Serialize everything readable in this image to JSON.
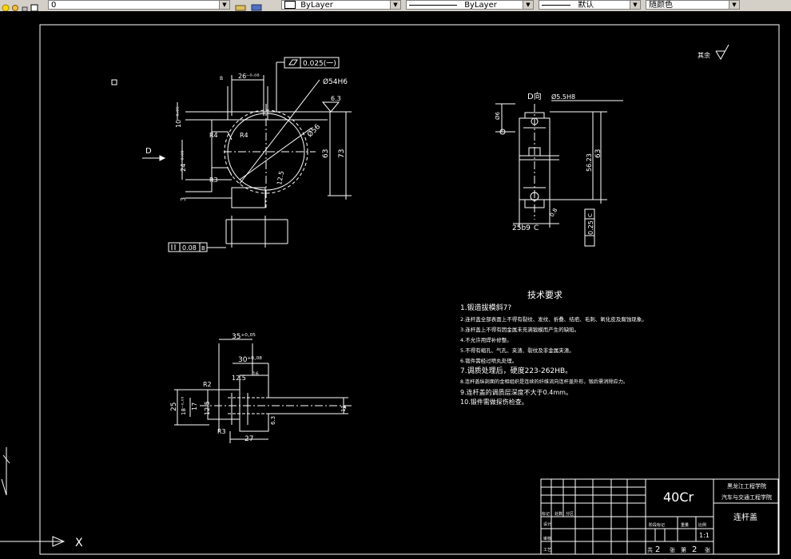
{
  "toolbar": {
    "layer_value": "0",
    "color_combo": "ByLayer",
    "linetype_combo": "ByLayer",
    "lineweight_combo": "默认",
    "plotstyle_combo": "随颜色"
  },
  "drawing": {
    "roughness_note": "其余",
    "view_arrow_label": "D",
    "view_d_label": "D向",
    "flatness_tol": "0.025(一)",
    "parallel_tol": "0.08",
    "parallel_datum": "B",
    "perp_tol": "0.25",
    "perp_datum": "C",
    "dims_main": {
      "d26": "26⁻⁰·⁰⁸",
      "d54": "Ø54H6",
      "d56": "Ø56",
      "d63": "63",
      "d73": "73",
      "r4a": "R4",
      "r4b": "R4",
      "d12_5": "12.5",
      "d10": "10⁻⁰·⁰⁵",
      "d24": "24⁻⁰·⁰⁸",
      "d3": "3",
      "r3": "R3",
      "rough63": "6.3"
    },
    "dims_side": {
      "d55": "Ø5.5H8",
      "d6": "Ø6",
      "d5623": "56.23",
      "d63": "63",
      "d25b9": "25b9",
      "rough16": "1.6",
      "rough32": "3.2",
      "rough08": "0.8"
    },
    "dims_bottom": {
      "d35": "35⁺⁰·⁰⁵",
      "d30": "30⁺⁰·⁰⁸",
      "d12_5": "12.5",
      "d16": "16",
      "d25": "25",
      "d17": "17",
      "d18": "18⁻⁰·⁰⁵",
      "d12_5v": "12.5",
      "d27": "27",
      "r2": "R2",
      "r3": "R3",
      "r05": "R0.5",
      "d4": "4",
      "d11": "11",
      "rough": "6.3"
    },
    "tech_title": "技术要求",
    "tech_items": [
      "1.锻造拔模斜7?",
      "2.连杆盖全部表面上不得有裂纹、发纹、折叠、结疤、毛刺、氧化皮及腐蚀现象。",
      "3.连杆盖上不得有因金属未充满锻模而产生的缺陷。",
      "4.不允许用焊补修整。",
      "5.不得有缩孔、气孔、夹渣、裂纹及非金属夹渣。",
      "6.锻件需经过喷丸处理。",
      "7.调质处理后，硬度223-262HB。",
      "8.连杆盖纵剖面的金相组织是连续的纤维流向连杆盖外形，锻后需消除应力。",
      "9.连杆盖的调质层深度不大于0.4mm。",
      "10.锻件需做探伤检查。"
    ],
    "title_block": {
      "material": "40Cr",
      "school": "黑龙江工程学院",
      "dept": "汽车与交通工程学院",
      "part_name": "连杆盖",
      "scale": "1:1",
      "sheet_total_label": "共",
      "sheet_total": "2",
      "sheet_label": "张",
      "sheet_num_label": "第",
      "sheet_num": "2",
      "sheet_unit": "张",
      "row_labels": [
        "标记",
        "处数",
        "分区",
        "设计",
        "审核",
        "工艺"
      ],
      "stage_label": "阶段标记",
      "weight_label": "重量",
      "scale_label": "比例"
    },
    "ucs_x": "X"
  }
}
